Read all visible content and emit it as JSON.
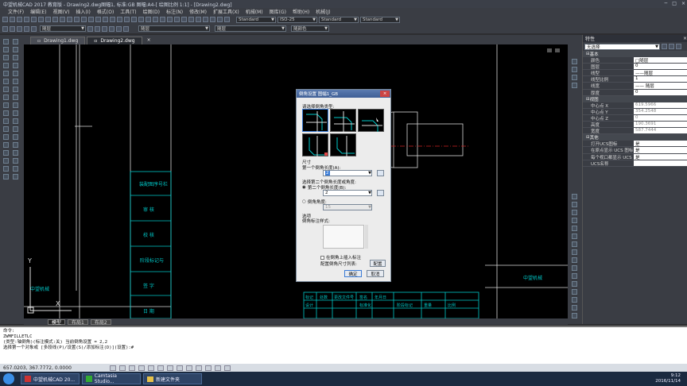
{
  "title_bar": {
    "title": "中望机械CAD 2017 教育版 - Drawing2.dwg图幅1, 标准:GB 图幅:A4-[ 绘图比例 1:1] - [Drawing2.dwg]",
    "controls": [
      "─",
      "□",
      "×"
    ]
  },
  "menu": [
    "文件(F)",
    "编辑(E)",
    "视图(V)",
    "插入(I)",
    "格式(O)",
    "工具(T)",
    "绘图(D)",
    "标注(N)",
    "修改(M)",
    "扩展工具(X)",
    "机械(M)",
    "图库(G)",
    "帮助(H)",
    "机械(J)"
  ],
  "toolbar": {
    "layer_combo": "随层",
    "linetype_combo": "随层",
    "lineweight_combo": "随层",
    "color_combo": "随颜色",
    "text_style": "Standard",
    "dim_style": "ISO-25",
    "table_style": "Standard",
    "mleader_style": "Standard"
  },
  "doc_tabs": [
    "Drawing1.dwg",
    "Drawing2.dwg"
  ],
  "doc_tab_close": "×",
  "layout_tabs": [
    "模型",
    "布局1",
    "布局2"
  ],
  "canvas": {
    "title_cells": [
      "装配图序号栏",
      "审 核",
      "校 核",
      "阶段标记与",
      "签 字",
      "日 期"
    ],
    "table_cells": [
      "标记",
      "处数",
      "更改文件号",
      "签名",
      "年月日",
      "设计",
      "标准化",
      "阶段标记",
      "重量",
      "比例"
    ],
    "left_label": "中望机械",
    "right_label": "中望机械",
    "axis_y": "Y",
    "axis_x": "X"
  },
  "dialog": {
    "title": "倒角设置 图幅1_GB",
    "close": "×",
    "choose_type_label": "请选择倒角类型:",
    "size_label": "尺寸",
    "first_length_label": "第一个倒角长度(A):",
    "first_length_value": "2",
    "choose_second_label": "选择第二个倒角长度或角度:",
    "second_length_label": "第二个倒角长度(B):",
    "second_length_value": "2",
    "angle_label": "倒角角度:",
    "angle_value": "15",
    "options_label": "选项",
    "dim_style_label": "倒角标注样式:",
    "insert_dim_label": "在倒角上插入标注",
    "config_list_label": "配置倒角尺寸列表:",
    "config_button": "配置",
    "ok_button": "确定",
    "cancel_button": "取消"
  },
  "properties": {
    "header": "特性",
    "selector": "无选择",
    "sections": [
      {
        "name": "基本",
        "rows": [
          [
            "颜色",
            "□随层"
          ],
          [
            "图层",
            "0"
          ],
          [
            "线型",
            "——随层"
          ],
          [
            "线型比例",
            "1"
          ],
          [
            "线宽",
            "—— 随层"
          ],
          [
            "厚度",
            "0"
          ]
        ]
      },
      {
        "name": "视图",
        "rows": [
          [
            "中心点 X",
            "619.5966"
          ],
          [
            "中心点 Y",
            "354.2548"
          ],
          [
            "中心点 Z",
            "0"
          ],
          [
            "高度",
            "190.3691"
          ],
          [
            "宽度",
            "587.7444"
          ]
        ]
      },
      {
        "name": "其他",
        "rows": [
          [
            "打开UCS图标",
            "是"
          ],
          [
            "在原点显示 UCS 图标",
            "是"
          ],
          [
            "每个视口都显示 UCS",
            "是"
          ],
          [
            "UCS名称",
            ""
          ]
        ]
      }
    ]
  },
  "command": {
    "lines": [
      "命令:",
      "ZWMFILLETLC",
      "(类型:轴倒角)(标注模式:关) 当前倒角设置 = 2,2",
      "选择第一个对象或 [多段线(P)/设置(S)/添加标注(D)](设置):#"
    ]
  },
  "status": {
    "coords": "657.0203, 367.7772, 0.0000"
  },
  "taskbar": {
    "buttons": [
      "中望机械CAD 20...",
      "Camtasia Studio...",
      "新建文件夹"
    ],
    "time": "9:12",
    "date": "2016/11/14"
  },
  "colors": {
    "canvas_bg": "#000000",
    "title_block": "#00c8c8",
    "accent": "#3f5f96"
  }
}
